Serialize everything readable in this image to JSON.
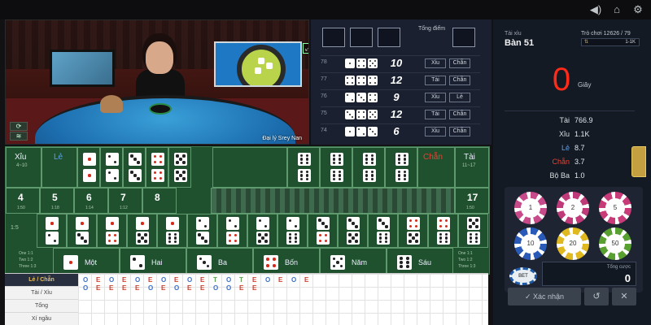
{
  "colors": {
    "accent_red": "#ff2a18",
    "table_green": "#20512f",
    "panel_dark": "#141a24",
    "le_blue": "#5aa0e8",
    "chan_red": "#e84030"
  },
  "video": {
    "dealer_name": "Đại lý Srey Nan"
  },
  "history": {
    "header_label": "Tổng điểm",
    "rows": [
      {
        "num": "78",
        "dice": [
          1,
          4,
          5
        ],
        "sum": "10",
        "tags": [
          "Xỉu",
          "Chẵn"
        ]
      },
      {
        "num": "77",
        "dice": [
          4,
          4,
          4
        ],
        "sum": "12",
        "tags": [
          "Tài",
          "Chẵn"
        ]
      },
      {
        "num": "76",
        "dice": [
          2,
          3,
          4
        ],
        "sum": "9",
        "tags": [
          "Xỉu",
          "Lẻ"
        ]
      },
      {
        "num": "75",
        "dice": [
          3,
          4,
          5
        ],
        "sum": "12",
        "tags": [
          "Tài",
          "Chẵn"
        ]
      },
      {
        "num": "74",
        "dice": [
          1,
          2,
          3
        ],
        "sum": "6",
        "tags": [
          "Xỉu",
          "Chẵn"
        ]
      }
    ]
  },
  "info": {
    "table_label": "Tài xỉu",
    "table_name": "Bàn 51",
    "round_info": "Trò chơi 12626 / 79",
    "limit": "1-1K",
    "timer": "0",
    "timer_unit": "Giây",
    "stats": [
      {
        "label": "Tài",
        "value": "766.9",
        "color": "#d8dde0"
      },
      {
        "label": "Xỉu",
        "value": "1.1K",
        "color": "#d8dde0"
      },
      {
        "label": "Lẻ",
        "value": "8.7",
        "color": "#5aa0e8"
      },
      {
        "label": "Chẵn",
        "value": "3.7",
        "color": "#e84030"
      },
      {
        "label": "Bộ Ba",
        "value": "1.0",
        "color": "#d8dde0"
      }
    ],
    "chips": [
      {
        "value": "1",
        "color": "#c74a8a"
      },
      {
        "value": "2",
        "color": "#c03a7a"
      },
      {
        "value": "5",
        "color": "#c83a78"
      },
      {
        "value": "10",
        "color": "#2a5ab8"
      },
      {
        "value": "20",
        "color": "#e0b820"
      },
      {
        "value": "50",
        "color": "#58a030"
      }
    ],
    "total_label": "Tổng cược",
    "total_value": "0",
    "bet_label": "BET",
    "confirm_label": "✓ Xác nhận",
    "undo_label": "↺",
    "clear_label": "✕"
  },
  "board": {
    "xiu_label": "Xỉu",
    "xiu_range": "4~10",
    "le_label": "Lẻ",
    "chan_label": "Chẵn",
    "tai_label": "Tài",
    "tai_range": "11~17",
    "triples": [
      1,
      2,
      3,
      4,
      5
    ],
    "totals": [
      {
        "num": "4",
        "odds": "1:50"
      },
      {
        "num": "5",
        "odds": "1:18"
      },
      {
        "num": "6",
        "odds": "1:14"
      },
      {
        "num": "7",
        "odds": "1:12"
      },
      {
        "num": "8",
        "odds": ""
      },
      {
        "num": "17",
        "odds": "1:50"
      }
    ],
    "pair_odds": "1:5",
    "single_odds": [
      "One 1:1",
      "Two 1:2",
      "Three 1:3"
    ],
    "singles": [
      {
        "face": 1,
        "label": "Một"
      },
      {
        "face": 2,
        "label": "Hai"
      },
      {
        "face": 3,
        "label": "Ba"
      },
      {
        "face": 4,
        "label": "Bốn"
      },
      {
        "face": 5,
        "label": "Năm"
      },
      {
        "face": 6,
        "label": "Sáu"
      }
    ]
  },
  "road": {
    "labels": [
      "Lẻ / Chẵn",
      "Tài / Xỉu",
      "Tổng",
      "Xí ngầu"
    ],
    "row1": [
      "O",
      "E",
      "O",
      "E",
      "O",
      "E",
      "O",
      "E",
      "O",
      "E",
      "T",
      "O",
      "T",
      "E",
      "O",
      "E",
      "O",
      "E"
    ],
    "row2": [
      "O",
      "E",
      "E",
      "E",
      "E",
      "O",
      "E",
      "O",
      "E",
      "E",
      "O",
      "O",
      "E",
      "E"
    ]
  }
}
